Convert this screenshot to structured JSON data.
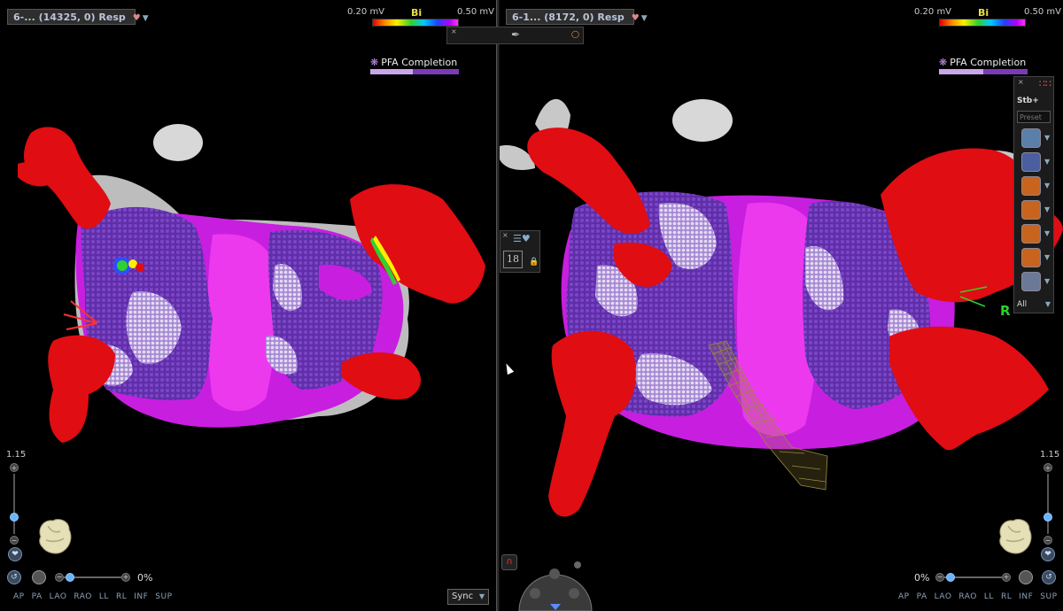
{
  "left_view": {
    "title": "6-... (14325, 0) Resp",
    "scale": {
      "min": "0.20 mV",
      "mode": "Bi",
      "max": "0.50 mV"
    },
    "pfa": {
      "label": "PFA Completion",
      "progress": 0.48
    },
    "zoom": "1.15",
    "rotation_pct": "0%",
    "views": [
      "AP",
      "PA",
      "LAO",
      "RAO",
      "LL",
      "RL",
      "INF",
      "SUP"
    ],
    "sync_label": "Sync"
  },
  "right_view": {
    "title": "6-1... (8172, 0) Resp",
    "scale": {
      "min": "0.20 mV",
      "mode": "Bi",
      "max": "0.50 mV"
    },
    "pfa": {
      "label": "PFA Completion",
      "progress": 0.5
    },
    "zoom": "1.15",
    "rotation_pct": "0%",
    "views": [
      "AP",
      "PA",
      "LAO",
      "RAO",
      "LL",
      "RL",
      "INF",
      "SUP"
    ],
    "orientation_label": "R"
  },
  "mid_tool": {
    "count": "18"
  },
  "tool_panel": {
    "stb_label": "Stb+",
    "preset_label": "Preset",
    "filter_label": "All",
    "tools": [
      {
        "icon": "catheter-icon",
        "color": "#5a7fa8"
      },
      {
        "icon": "catheter-tip-icon",
        "color": "#4a5ea0"
      },
      {
        "icon": "mesh-surface-icon",
        "color": "#c8641e"
      },
      {
        "icon": "lesion-marker-icon",
        "color": "#c8641e"
      },
      {
        "icon": "ring-icon",
        "color": "#c8641e"
      },
      {
        "icon": "color-ring-icon",
        "color": "#c8641e"
      },
      {
        "icon": "ruler-icon",
        "color": "#6a7a96"
      }
    ]
  },
  "colors": {
    "tissue_red": "#e00d12",
    "ablation_magenta": "#c81ee0",
    "lesion_purple": "#6a32b4",
    "lesion_light": "#c3aee0",
    "background": "#000000"
  }
}
